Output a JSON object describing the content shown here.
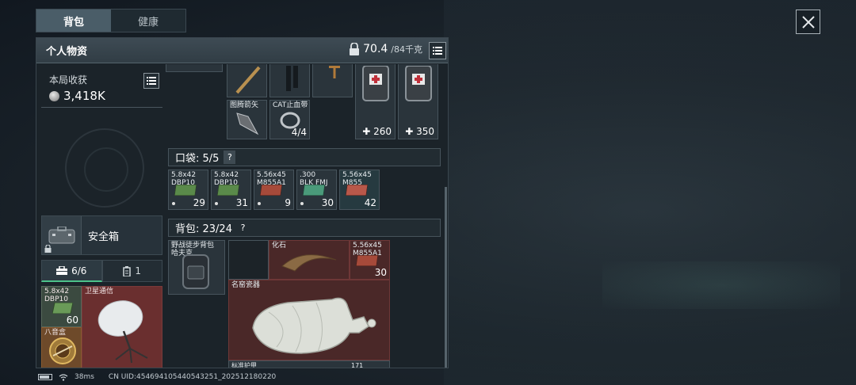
{
  "top_tabs": [
    {
      "label": "背包",
      "active": true
    },
    {
      "label": "健康",
      "active": false
    }
  ],
  "panel": {
    "title": "个人物资",
    "weight_current": "70.4",
    "weight_max": "/84千克"
  },
  "harvest": {
    "label": "本局收获",
    "value": "3,418K"
  },
  "safe_box": {
    "label": "安全箱"
  },
  "sub_tabs": [
    {
      "label": "6/6",
      "icon": "toolbox-icon",
      "active": true
    },
    {
      "label": "1",
      "icon": "canister-icon",
      "active": false
    }
  ],
  "safe_slots": [
    {
      "name": "5.8x42\nDBP10",
      "count": "60"
    },
    {
      "name": "卫星通信",
      "count": ""
    },
    {
      "name": "八音盒",
      "count": ""
    }
  ],
  "top_items": [
    {
      "name": "图腾箭矢",
      "count": ""
    },
    {
      "name": "CAT止血带",
      "count": "4/4"
    },
    {
      "name": "",
      "count": "260"
    },
    {
      "name": "",
      "count": "350"
    }
  ],
  "pocket": {
    "label": "口袋: 5/5",
    "items": [
      {
        "name": "5.8x42\nDBP10",
        "count": "29",
        "color": "#5a8a4a"
      },
      {
        "name": "5.8x42\nDBP10",
        "count": "31",
        "color": "#5a8a4a"
      },
      {
        "name": "5.56x45\nM855A1",
        "count": "9",
        "color": "#a64a3a"
      },
      {
        "name": ".300\nBLK FMJ",
        "count": "30",
        "color": "#4a9a7a"
      },
      {
        "name": "5.56x45\nM855",
        "count": "42",
        "color": "#b8584a"
      }
    ]
  },
  "backpack": {
    "label": "背包: 23/24",
    "items": [
      {
        "name": "野战徒步背包\n哈夫克",
        "count": ""
      },
      {
        "name": "化石",
        "count": ""
      },
      {
        "name": "5.56x45\nM855A1",
        "count": "30"
      },
      {
        "name": "名窑瓷器",
        "count": ""
      },
      {
        "name": "标准护甲",
        "count": "171"
      }
    ]
  },
  "status": {
    "ping": "38ms",
    "uid": "CN UID:454694105440543251_202512180220"
  },
  "colors": {
    "accent": "#4cc28a",
    "red_slot": "#5c2a2a"
  }
}
